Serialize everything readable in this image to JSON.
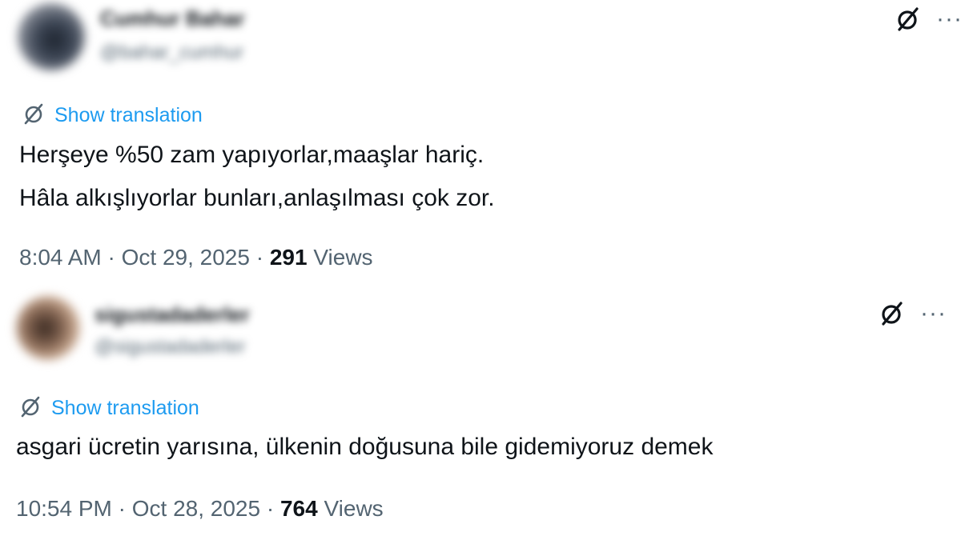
{
  "tweets": [
    {
      "display_name": "Cumhur Bahar",
      "handle": "@bahar_cumhur",
      "translation_label": "Show translation",
      "text_lines": [
        "Herşeye %50 zam yapıyorlar,maaşlar hariç.",
        "Hâla alkışlıyorlar bunları,anlaşılması çok zor."
      ],
      "time": "8:04 AM",
      "date": "Oct 29, 2025",
      "separator": "·",
      "views_count": "291",
      "views_label": "Views"
    },
    {
      "display_name": "sigustadaderler",
      "handle": "@sigustadaderler",
      "translation_label": "Show translation",
      "text_lines": [
        "asgari ücretin yarısına, ülkenin doğusuna bile gidemiyoruz demek"
      ],
      "time": "10:54 PM",
      "date": "Oct 28, 2025",
      "separator": "·",
      "views_count": "764",
      "views_label": "Views"
    }
  ],
  "icons": {
    "grok": "grok-icon",
    "more": "more-icon",
    "translate": "translate-icon",
    "more_glyph": "···"
  },
  "colors": {
    "link": "#1d9bf0",
    "text": "#0f1419",
    "secondary": "#536471"
  }
}
